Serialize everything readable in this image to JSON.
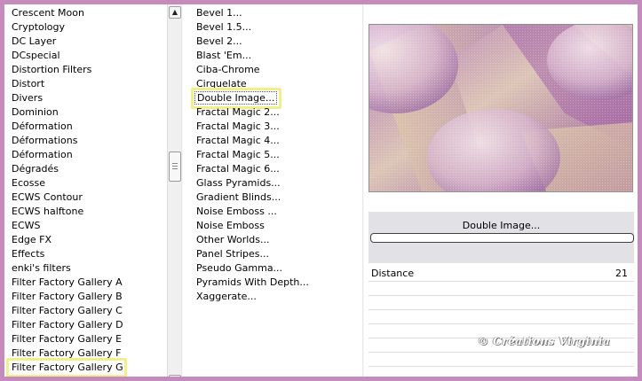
{
  "filter_list": {
    "items": [
      "Crescent Moon",
      "Cryptology",
      "DC Layer",
      "DCspecial",
      "Distortion Filters",
      "Distort",
      "Divers",
      "Dominion",
      "Déformation",
      "Déformations",
      "Déformation",
      "Dégradés",
      "Ecosse",
      "ECWS Contour",
      "ECWS halftone",
      "ECWS",
      "Edge FX",
      "Effects",
      "enki's filters",
      "Filter Factory Gallery A",
      "Filter Factory Gallery B",
      "Filter Factory Gallery C",
      "Filter Factory Gallery D",
      "Filter Factory Gallery E",
      "Filter Factory Gallery F",
      "Filter Factory Gallery G"
    ],
    "selected_index": 25
  },
  "scrollbar": {
    "up_icon": "chevron-up-icon",
    "down_icon": "chevron-down-icon"
  },
  "effect_list": {
    "items": [
      "Bevel 1...",
      "Bevel 1.5...",
      "Bevel 2...",
      "Blast 'Em...",
      "Ciba-Chrome",
      "Cirquelate",
      "Double Image...",
      "Fractal Magic 2...",
      "Fractal Magic 3...",
      "Fractal Magic 4...",
      "Fractal Magic 5...",
      "Fractal Magic 6...",
      "Glass Pyramids...",
      "Gradient Blinds...",
      "Noise Emboss ...",
      "Noise Emboss",
      "Other Worlds...",
      "Panel Stripes...",
      "Pseudo Gamma...",
      "Pyramids With Depth...",
      "Xaggerate..."
    ],
    "selected_index": 6
  },
  "panel": {
    "effect_name": "Double Image...",
    "param_label": "Distance",
    "param_value": "21",
    "watermark": "© Créations Virginia"
  },
  "colors": {
    "background": "#c58bbd",
    "highlight": "#f1ee8c",
    "preview_purple": "#9c5fa3",
    "preview_tan": "#d8c0a0"
  }
}
